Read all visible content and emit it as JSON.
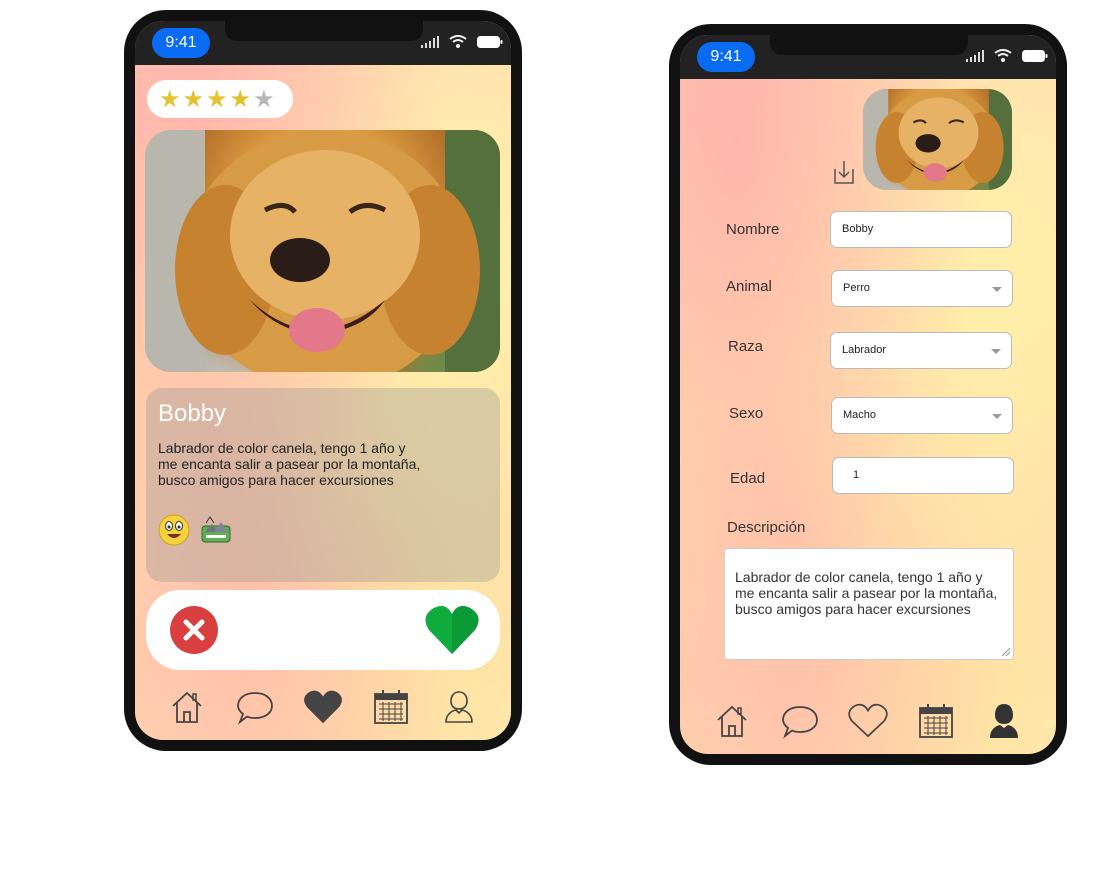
{
  "status_bar": {
    "time": "9:41"
  },
  "match_screen": {
    "rating": {
      "filled": 4,
      "total": 5
    },
    "pet": {
      "name": "Bobby",
      "description": "Labrador de color canela, tengo 1 año y me encanta salir a pasear por la montaña, busco amigos para hacer excursiones",
      "emojis": [
        "smiling-face-emoji",
        "mountain-hiking-emoji"
      ]
    },
    "actions": {
      "reject_icon": "close-icon",
      "like_icon": "heart-icon"
    },
    "nav": [
      "home-icon",
      "chat-icon",
      "heart-icon",
      "calendar-icon",
      "profile-icon"
    ],
    "active_nav": "heart-icon"
  },
  "profile_screen": {
    "fields": {
      "nombre": {
        "label": "Nombre",
        "value": "Bobby"
      },
      "animal": {
        "label": "Animal",
        "value": "Perro"
      },
      "raza": {
        "label": "Raza",
        "value": "Labrador"
      },
      "sexo": {
        "label": "Sexo",
        "value": "Macho"
      },
      "edad": {
        "label": "Edad",
        "value": "1"
      },
      "descripcion": {
        "label": "Descripción",
        "value": "Labrador de color canela, tengo 1 año y me encanta salir a pasear por la montaña, busco amigos para hacer excursiones"
      }
    },
    "nav": [
      "home-icon",
      "chat-icon",
      "heart-icon",
      "calendar-icon",
      "profile-icon"
    ],
    "active_nav": "profile-icon"
  },
  "colors": {
    "accent_blue": "#0a6cf5",
    "star_gold": "#e2c22e",
    "reject_red": "#d93f3f",
    "like_green": "#0fab3c"
  }
}
